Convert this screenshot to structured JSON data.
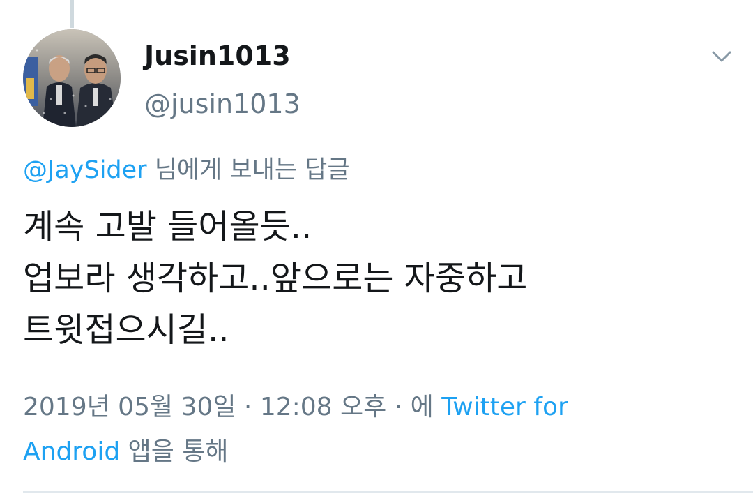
{
  "user": {
    "display_name": "Jusin1013",
    "handle": "@jusin1013",
    "avatar_icon": "profile-photo"
  },
  "reply_context": {
    "mention": "@JaySider",
    "suffix": " 님에게 보내는 답글"
  },
  "tweet": {
    "lines": [
      "계속 고발 들어올듯..",
      "업보라 생각하고..앞으로는 자중하고",
      "트윗접으시길.."
    ]
  },
  "meta": {
    "date": "2019년 05월 30일",
    "separator": " · ",
    "time": "12:08 오후",
    "via_prefix": "에 ",
    "source_line1": "Twitter for",
    "source_line2": "Android",
    "via_suffix": " 앱을 통해"
  },
  "colors": {
    "accent": "#1da1f2",
    "secondary_text": "#657786",
    "primary_text": "#14171a",
    "divider": "#e1e8ed"
  }
}
